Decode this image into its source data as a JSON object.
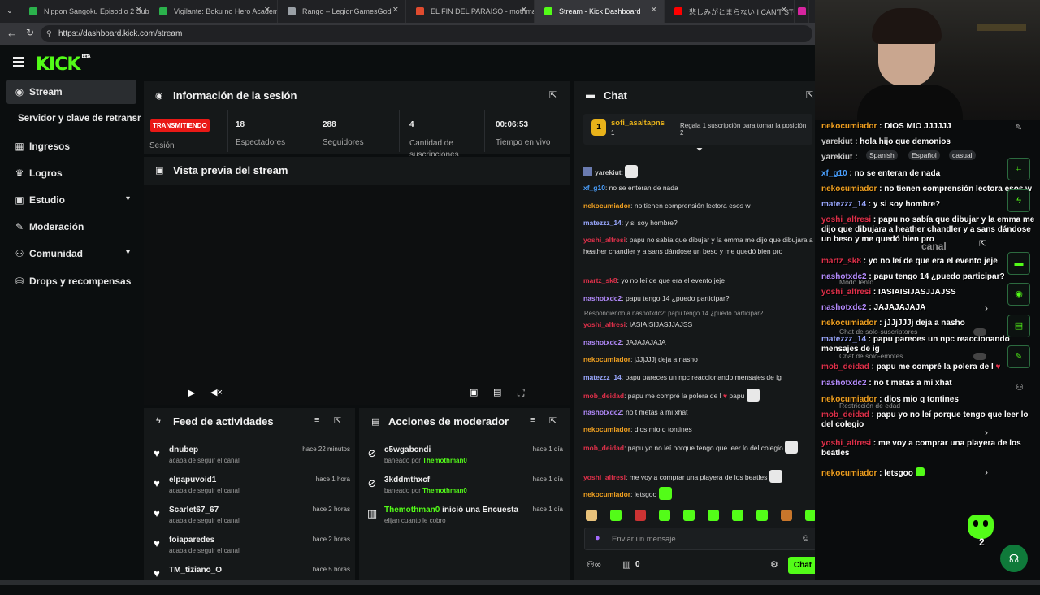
{
  "browser": {
    "tabs": [
      {
        "label": "Nippon Sangoku Episodio 2 Sub",
        "color": "#2bb24c"
      },
      {
        "label": "Vigilante: Boku no Hero Academi",
        "color": "#2bb24c"
      },
      {
        "label": "Rango – LegionGamesGod",
        "color": "#9aa0a6"
      },
      {
        "label": "EL FIN DEL PARAISO - mothman",
        "color": "#e04b2f"
      },
      {
        "label": "Stream - Kick Dashboard",
        "color": "#53fc18"
      },
      {
        "label": "悲しみがとまらない  I CAN'T STOP T",
        "color": "#ff0000"
      },
      {
        "label": "T",
        "color": "#d6249f"
      }
    ],
    "url": "https://dashboard.kick.com/stream"
  },
  "logo": "KICK",
  "logo_tag": "BETA",
  "sidebar": {
    "items": [
      {
        "label": "Stream",
        "icon": "broadcast-icon"
      },
      {
        "label": "Servidor y clave de retransm",
        "icon": ""
      },
      {
        "label": "Ingresos",
        "icon": "revenue-icon"
      },
      {
        "label": "Logros",
        "icon": "trophy-icon"
      },
      {
        "label": "Estudio",
        "icon": "studio-icon"
      },
      {
        "label": "Moderación",
        "icon": "wrench-icon"
      },
      {
        "label": "Comunidad",
        "icon": "community-icon"
      },
      {
        "label": "Drops y recompensas",
        "icon": "drops-icon"
      }
    ]
  },
  "session": {
    "title": "Información de la sesión",
    "status": "TRANSMITIENDO",
    "status_label": "Sesión",
    "stats": [
      {
        "value": "18",
        "label": "Espectadores"
      },
      {
        "value": "288",
        "label": "Seguidores"
      },
      {
        "value": "4",
        "label": "Cantidad de suscripciones"
      },
      {
        "value": "00:06:53",
        "label": "Tiempo en vivo"
      }
    ]
  },
  "preview": {
    "title": "Vista previa del stream"
  },
  "activity": {
    "title": "Feed de actividades",
    "items": [
      {
        "user": "dnubep",
        "action": "acaba de seguir el canal",
        "time": "hace 22 minutos"
      },
      {
        "user": "elpapuvoid1",
        "action": "acaba de seguir el canal",
        "time": "hace 1 hora"
      },
      {
        "user": "Scarlet67_67",
        "action": "acaba de seguir el canal",
        "time": "hace 2 horas"
      },
      {
        "user": "foiaparedes",
        "action": "acaba de seguir el canal",
        "time": "hace 2 horas"
      },
      {
        "user": "TM_tiziano_O",
        "action": "",
        "time": "hace 5 horas"
      }
    ]
  },
  "modactions": {
    "title": "Acciones de moderador",
    "items": [
      {
        "target": "c5wgabcndi",
        "detail": "baneado por",
        "by": "Themothman0",
        "time": "hace 1 día"
      },
      {
        "target": "3kddmthxcf",
        "detail": "baneado por",
        "by": "Themothman0",
        "time": "hace 1 día"
      },
      {
        "target": "Themothman0",
        "detail": "iniciò una Encuesta",
        "by": "elijan cuanto le cobro",
        "time": "hace 1 día"
      }
    ]
  },
  "chat": {
    "title": "Chat",
    "pinned_user": "sofi_asaltapns",
    "pinned_count": "1",
    "pinned_text": "Regala 1 suscripción para tomar la posición 2",
    "reply_hint": "Respondiendo a nashotxdc2: papu tengo 14 ¿puedo participar?",
    "messages": [
      {
        "user": "yarekiut",
        "text": "",
        "color": "#c9c9c9"
      },
      {
        "user": "xf_g10",
        "text": "no se enteran de nada",
        "color": "#4aa0ff"
      },
      {
        "user": "nekocumiador",
        "text": "no tienen comprensión lectora esos w",
        "color": "#f0a020"
      },
      {
        "user": "matezzz_14",
        "text": "y si soy hombre?",
        "color": "#9aa8ff"
      },
      {
        "user": "yoshi_alfresi",
        "text": "papu no sabía que dibujar y la emma me dijo que dibujara a heather chandler y a sans dándose un beso y me quedó bien pro",
        "color": "#e0304a"
      },
      {
        "user": "martz_sk8",
        "text": "yo no leí de que era el evento jeje",
        "color": "#e0304a"
      },
      {
        "user": "nashotxdc2",
        "text": "papu tengo 14 ¿puedo participar?",
        "color": "#b58cff"
      },
      {
        "user": "yoshi_alfresi",
        "text": "IASIAISIJASJJAJSS",
        "color": "#e0304a"
      },
      {
        "user": "nashotxdc2",
        "text": "JAJAJAJAJA",
        "color": "#b58cff"
      },
      {
        "user": "nekocumiador",
        "text": "jJJjJJJj deja a nasho",
        "color": "#f0a020"
      },
      {
        "user": "matezzz_14",
        "text": "papu pareces un npc reaccionando mensajes de ig",
        "color": "#9aa8ff"
      },
      {
        "user": "mob_deidad",
        "text": "papu me compré la polera de l",
        "color": "#e0304a"
      },
      {
        "user": "nashotxdc2",
        "text": "no t metas a mi xhat",
        "color": "#b58cff"
      },
      {
        "user": "nekocumiador",
        "text": "dios mio q tontines",
        "color": "#f0a020"
      },
      {
        "user": "mob_deidad",
        "text": "papu yo no leí porque tengo que leer lo del colegio",
        "color": "#e0304a"
      },
      {
        "user": "yoshi_alfresi",
        "text": "me voy a comprar una playera de los beatles",
        "color": "#e0304a"
      },
      {
        "user": "nekocumiador",
        "text": "letsgoo",
        "color": "#f0a020"
      }
    ],
    "heart_word": "papu",
    "input_placeholder": "Enviar un mensaje",
    "points": "0",
    "send_label": "Chat"
  },
  "overlay": {
    "lines": [
      {
        "user": "nekocumiador",
        "text": "DIOS MIO JJJJJJ",
        "color": "#f0a020"
      },
      {
        "user": "yarekiut",
        "text": "hola hijo que demonios",
        "color": "#c9c9c9"
      },
      {
        "user": "yarekiut",
        "text": "",
        "color": "#c9c9c9"
      },
      {
        "user": "xf_g10",
        "text": "no se enteran de nada",
        "color": "#4aa0ff"
      },
      {
        "user": "nekocumiador",
        "text": "no tienen comprensión lectora esos w",
        "color": "#f0a020"
      },
      {
        "user": "matezzz_14",
        "text": "y si soy hombre?",
        "color": "#9aa8ff"
      },
      {
        "user": "yoshi_alfresi",
        "text": "papu no sabía que dibujar y la emma me dijo que dibujara a heather chandler y a sans dándose un beso y me quedó bien pro",
        "color": "#e0304a"
      },
      {
        "user": "martz_sk8",
        "text": "yo no leí de que era el evento jeje",
        "color": "#e0304a"
      },
      {
        "user": "nashotxdc2",
        "text": "papu tengo 14 ¿puedo participar?",
        "color": "#b58cff"
      },
      {
        "user": "yoshi_alfresi",
        "text": "IASIAISIJASJJAJSS",
        "color": "#e0304a"
      },
      {
        "user": "nashotxdc2",
        "text": "JAJAJAJAJA",
        "color": "#b58cff"
      },
      {
        "user": "nekocumiador",
        "text": "jJJjJJJj deja a nasho",
        "color": "#f0a020"
      },
      {
        "user": "matezzz_14",
        "text": "papu pareces un npc reaccionando mensajes de ig",
        "color": "#9aa8ff"
      },
      {
        "user": "mob_deidad",
        "text": "papu me compré la polera de l",
        "color": "#e0304a"
      },
      {
        "user": "nashotxdc2",
        "text": "no t metas a mi xhat",
        "color": "#b58cff"
      },
      {
        "user": "nekocumiador",
        "text": "dios mio q tontines",
        "color": "#f0a020"
      },
      {
        "user": "mob_deidad",
        "text": "papu yo no leí porque tengo que leer lo del colegio",
        "color": "#e0304a"
      },
      {
        "user": "yoshi_alfresi",
        "text": "me voy a comprar una playera de los beatles",
        "color": "#e0304a"
      },
      {
        "user": "nekocumiador",
        "text": "letsgoo",
        "color": "#f0a020"
      }
    ],
    "tags": [
      "Spanish",
      "Español",
      "casual"
    ],
    "ghost_labels": [
      "Modo lento",
      "Chat de solo-suscriptores",
      "Chat de solo-emotes",
      "Restricción de edad",
      "canal"
    ],
    "badge_count": "2"
  },
  "colors": {
    "accent": "#53fc18",
    "live": "#e91916",
    "panel": "#151819",
    "bg": "#0b0e0f"
  }
}
